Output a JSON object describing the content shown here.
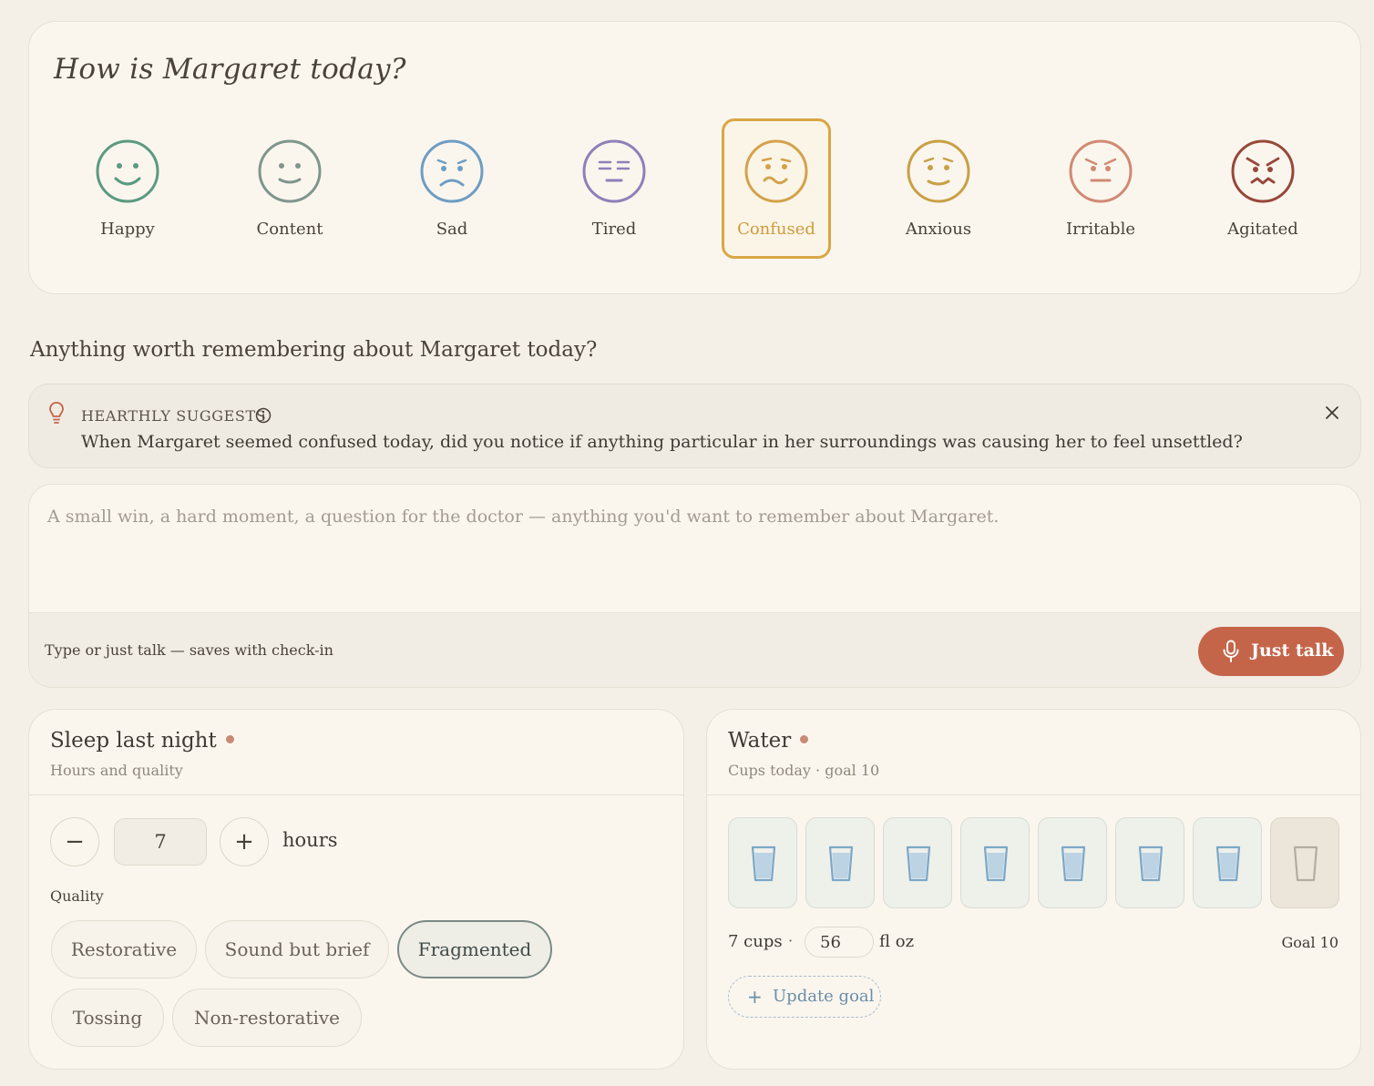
{
  "mood": {
    "title": "How is Margaret today?",
    "options": [
      {
        "label": "Happy",
        "color": "#5b9a80"
      },
      {
        "label": "Content",
        "color": "#7f968c"
      },
      {
        "label": "Sad",
        "color": "#6e9dc2"
      },
      {
        "label": "Tired",
        "color": "#8e80b8"
      },
      {
        "label": "Confused",
        "color": "#d4a24a"
      },
      {
        "label": "Anxious",
        "color": "#c9a045"
      },
      {
        "label": "Irritable",
        "color": "#d08a73"
      },
      {
        "label": "Agitated",
        "color": "#97483a"
      }
    ],
    "selected": "Confused"
  },
  "notes": {
    "heading": "Anything worth remembering about Margaret today?",
    "suggestion_label": "HEARTHLY SUGGESTS",
    "suggestion_text": "When Margaret seemed confused today, did you notice if anything particular in her surroundings was causing her to feel unsettled?",
    "placeholder": "A small win, a hard moment, a question for the doctor — anything you'd want to remember about Margaret.",
    "hint": "Type or just talk — saves with check-in",
    "talk_label": "Just talk"
  },
  "sleep": {
    "title": "Sleep last night",
    "subtitle": "Hours and quality",
    "minus": "−",
    "plus": "+",
    "hours": "7",
    "unit": "hours",
    "quality_label": "Quality",
    "qualities": [
      "Restorative",
      "Sound but brief",
      "Fragmented",
      "Tossing",
      "Non-restorative"
    ],
    "selected_quality": "Fragmented"
  },
  "water": {
    "title": "Water",
    "subtitle": "Cups today · goal 10",
    "cups_filled": 7,
    "cups_shown": 8,
    "cups_label": "7 cups",
    "separator": "·",
    "floz": "56",
    "floz_unit": "fl oz",
    "goal_text": "Goal 10",
    "update_goal_label": "Update goal",
    "plus_symbol": "+"
  },
  "colors": {
    "accent": "#c4654a",
    "selected_border": "#d9a645",
    "water": "#7ba7c7"
  }
}
